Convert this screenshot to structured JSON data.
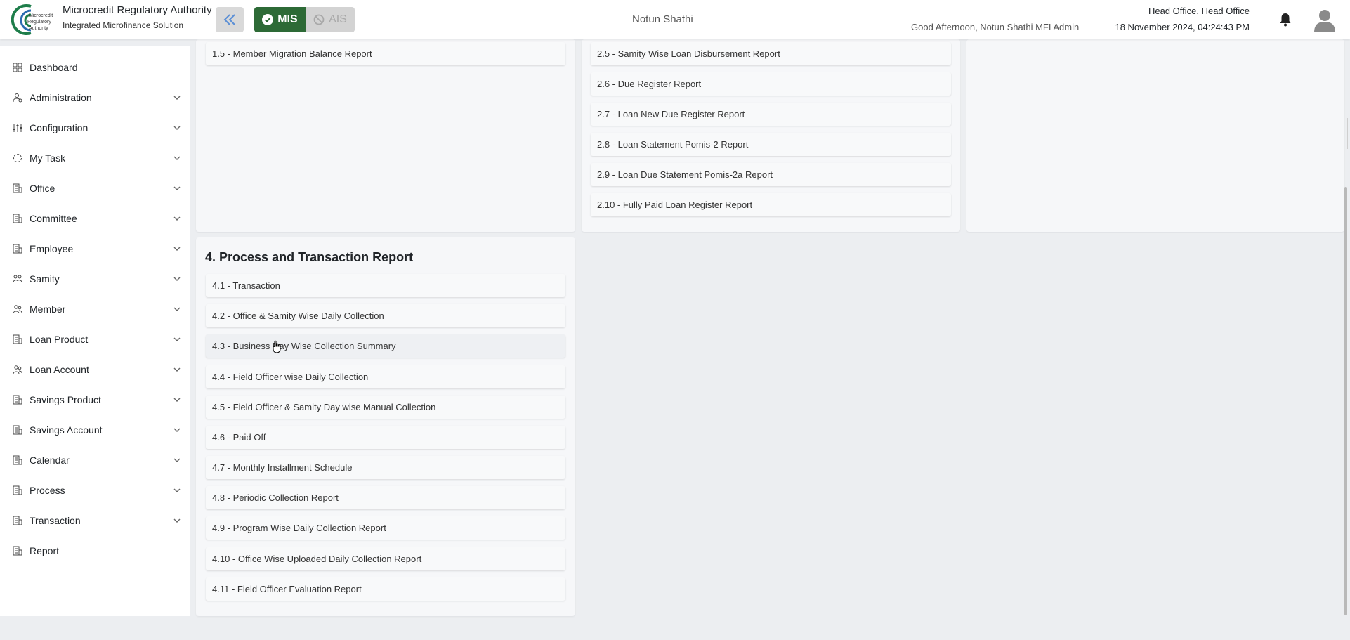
{
  "header": {
    "brand_title": "Microcredit Regulatory Authority",
    "brand_subtitle": "Integrated Microfinance Solution",
    "logo_text": [
      "Microcredit",
      "Regulatory",
      "Authority"
    ],
    "mis_label": "MIS",
    "ais_label": "AIS",
    "org_name": "Notun Shathi",
    "office": "Head Office, Head Office",
    "greeting": "Good Afternoon, Notun Shathi MFI Admin",
    "datetime": "18 November 2024, 04:24:43 PM"
  },
  "sidebar": {
    "items": [
      {
        "label": "Dashboard",
        "icon": "grid-icon",
        "expandable": false
      },
      {
        "label": "Administration",
        "icon": "users-cog-icon",
        "expandable": true
      },
      {
        "label": "Configuration",
        "icon": "sliders-icon",
        "expandable": true
      },
      {
        "label": "My Task",
        "icon": "cycle-icon",
        "expandable": true
      },
      {
        "label": "Office",
        "icon": "building-icon",
        "expandable": true
      },
      {
        "label": "Committee",
        "icon": "building-icon",
        "expandable": true
      },
      {
        "label": "Employee",
        "icon": "building-icon",
        "expandable": true
      },
      {
        "label": "Samity",
        "icon": "group-icon",
        "expandable": true
      },
      {
        "label": "Member",
        "icon": "people-icon",
        "expandable": true
      },
      {
        "label": "Loan Product",
        "icon": "building-icon",
        "expandable": true
      },
      {
        "label": "Loan Account",
        "icon": "people-icon",
        "expandable": true
      },
      {
        "label": "Savings Product",
        "icon": "building-icon",
        "expandable": true
      },
      {
        "label": "Savings Account",
        "icon": "building-icon",
        "expandable": true
      },
      {
        "label": "Calendar",
        "icon": "building-icon",
        "expandable": true
      },
      {
        "label": "Process",
        "icon": "building-icon",
        "expandable": true
      },
      {
        "label": "Transaction",
        "icon": "building-icon",
        "expandable": true
      },
      {
        "label": "Report",
        "icon": "building-icon",
        "expandable": false
      }
    ]
  },
  "reports": {
    "member_items": [
      "1.5 - Member Migration Balance Report"
    ],
    "loan_items": [
      "2.5 - Samity Wise Loan Disbursement Report",
      "2.6 - Due Register Report",
      "2.7 - Loan New Due Register Report",
      "2.8 - Loan Statement Pomis-2 Report",
      "2.9 - Loan Due Statement Pomis-2a Report",
      "2.10 - Fully Paid Loan Register Report"
    ],
    "process_title": "4. Process and Transaction Report",
    "process_items": [
      "4.1 - Transaction",
      "4.2 - Office & Samity Wise Daily Collection",
      "4.3 - Business Day Wise Collection Summary",
      "4.4 - Field Officer wise Daily Collection",
      "4.5 - Field Officer & Samity Day wise Manual Collection",
      "4.6 - Paid Off",
      "4.7 - Monthly Installment Schedule",
      "4.8 - Periodic Collection Report",
      "4.9 - Program Wise Daily Collection Report",
      "4.10 - Office Wise Uploaded Daily Collection Report",
      "4.11 - Field Officer Evaluation Report"
    ]
  },
  "colors": {
    "mis_green": "#2d6a36",
    "logo_green": "#1e7d4a",
    "logo_blue": "#2b6cb0"
  }
}
